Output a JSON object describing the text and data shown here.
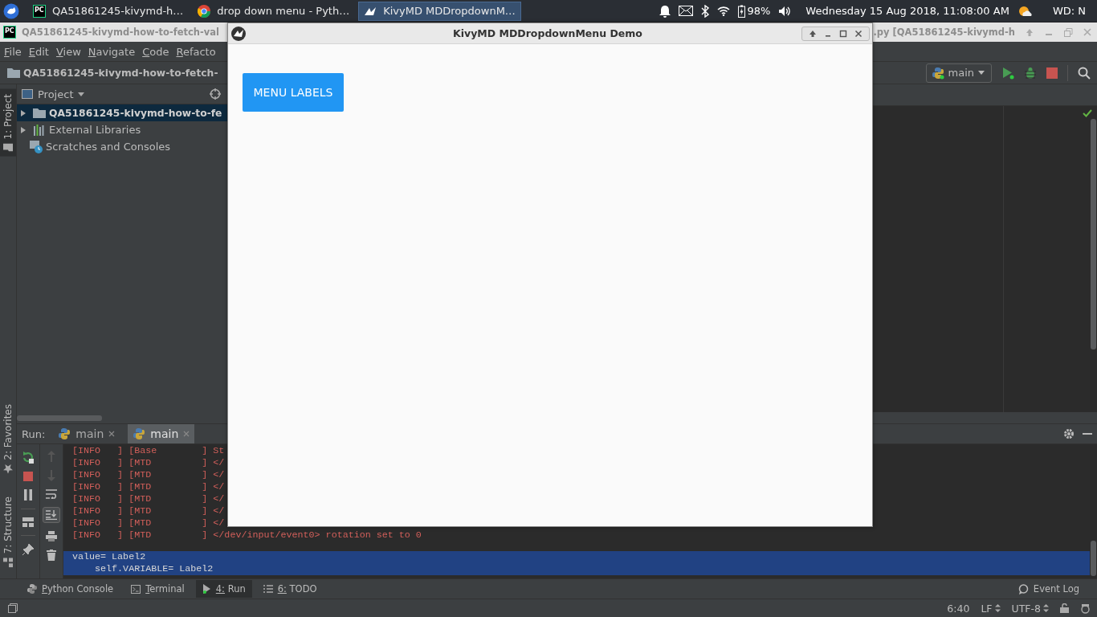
{
  "taskbar": {
    "tasks": [
      {
        "kind": "pycharm",
        "icon_text": "PC",
        "label": "QA51861245-kivymd-h…",
        "selected": false
      },
      {
        "kind": "chrome",
        "label": "drop down menu - Pyth…",
        "selected": false
      },
      {
        "kind": "kivy",
        "label": "KivyMD MDDropdownM…",
        "selected": true
      }
    ],
    "battery": "98%",
    "clock": "Wednesday 15 Aug 2018, 11:08:00 AM",
    "weather": "WD: N"
  },
  "ide": {
    "logo_text": "PC",
    "title_left": "QA51861245-kivymd-how-to-fetch-val",
    "title_right": ".py [QA51861245-kivymd-h",
    "menu": [
      "File",
      "Edit",
      "View",
      "Navigate",
      "Code",
      "Refacto"
    ],
    "breadcrumb": "QA51861245-kivymd-how-to-fetch-",
    "run_config": "main",
    "side_tabs": [
      {
        "kind": "project",
        "label": "1: Project",
        "selected": true
      },
      {
        "kind": "favorites",
        "label": "2: Favorites",
        "selected": false
      },
      {
        "kind": "structure",
        "label": "7: Structure",
        "selected": false
      }
    ],
    "project": {
      "header": "Project",
      "tree": [
        {
          "kind": "folder",
          "label": "QA51861245-kivymd-how-to-fe",
          "expanded": false,
          "selected": true
        },
        {
          "kind": "libraries",
          "label": "External Libraries",
          "expanded": false,
          "selected": false
        },
        {
          "kind": "scratches",
          "label": "Scratches and Consoles",
          "selected": false
        }
      ]
    },
    "run": {
      "label": "Run:",
      "tabs": [
        {
          "label": "main",
          "selected": false
        },
        {
          "label": "main",
          "selected": true
        }
      ],
      "log": [
        "[INFO   ] [Base        ] St",
        "[INFO   ] [MTD         ] </",
        "[INFO   ] [MTD         ] </",
        "[INFO   ] [MTD         ] </",
        "[INFO   ] [MTD         ] </",
        "[INFO   ] [MTD         ] </",
        "[INFO   ] [MTD         ] </",
        "[INFO   ] [MTD         ] </dev/input/event0> rotation set to 0"
      ],
      "output": [
        "value= Label2",
        "    self.VARIABLE= Label2"
      ]
    },
    "tool_tabs": [
      {
        "kind": "python",
        "label": "Python Console",
        "selected": false
      },
      {
        "kind": "terminal",
        "label": "Terminal",
        "selected": false
      },
      {
        "kind": "run",
        "label": "4: Run",
        "selected": true
      },
      {
        "kind": "todo",
        "label": "6: TODO",
        "selected": false
      }
    ],
    "event_log": "Event Log",
    "status": {
      "position": "6:40",
      "line_separator": "LF",
      "encoding": "UTF-8"
    }
  },
  "kivy_window": {
    "title": "KivyMD MDDropdownMenu Demo",
    "button": "MENU LABELS"
  }
}
